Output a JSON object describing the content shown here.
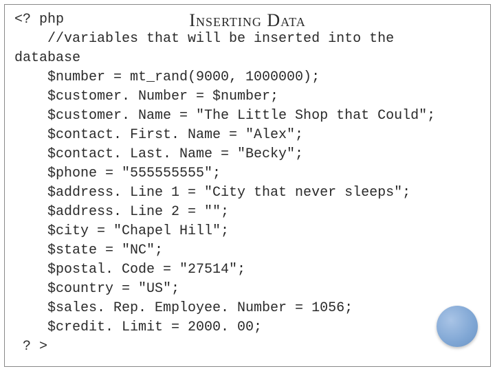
{
  "slide": {
    "heading": "Inserting Data",
    "code": {
      "open_tag": "<? php",
      "comment": "//variables that will be inserted into the",
      "database_word": "database",
      "lines": [
        "$number = mt_rand(9000, 1000000);",
        "$customer. Number = $number;",
        "$customer. Name = \"The Little Shop that Could\";",
        "$contact. First. Name = \"Alex\";",
        "$contact. Last. Name = \"Becky\";",
        "$phone = \"555555555\";",
        "$address. Line 1 = \"City that never sleeps\";",
        "$address. Line 2 = \"\";",
        "$city = \"Chapel Hill\";",
        "$state = \"NC\";",
        "$postal. Code = \"27514\";",
        "$country = \"US\";",
        "$sales. Rep. Employee. Number = 1056;",
        "$credit. Limit = 2000. 00;"
      ],
      "close_tag": " ? >"
    }
  }
}
